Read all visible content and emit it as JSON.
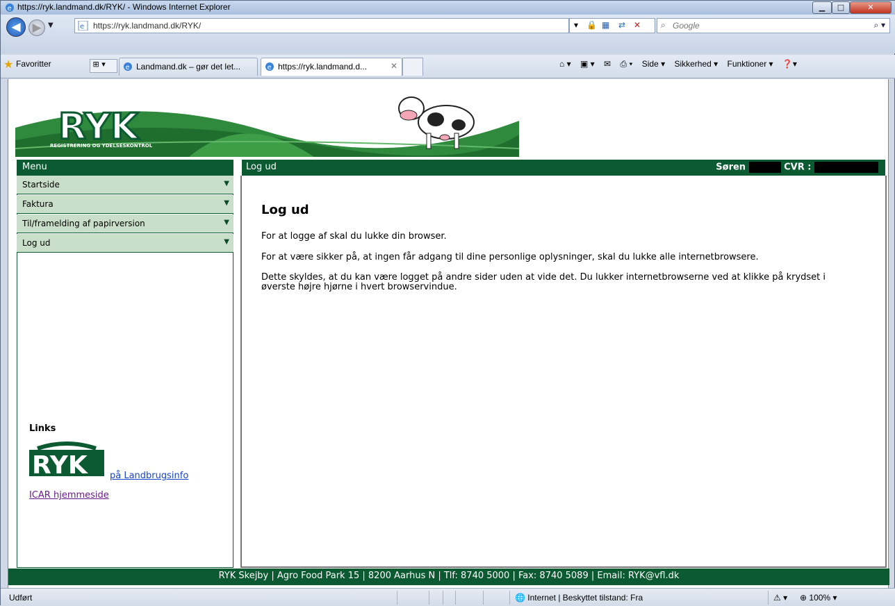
{
  "browser": {
    "title": "https://ryk.landmand.dk/RYK/ - Windows Internet Explorer",
    "address": "https://ryk.landmand.dk/RYK/",
    "search_placeholder": "Google",
    "favorites_label": "Favoritter",
    "tabs": [
      {
        "label": "Landmand.dk – gør det let..."
      },
      {
        "label": "https://ryk.landmand.d..."
      }
    ],
    "commands": [
      "Side ▾",
      "Sikkerhed ▾",
      "Funktioner ▾"
    ],
    "status_text": "Udført",
    "status_zone": "Internet | Beskyttet tilstand: Fra",
    "zoom": "100%"
  },
  "banner": {
    "logo_text": "RYK",
    "tagline": "REGISTRERING OG YDELSESKONTROL"
  },
  "sidebar": {
    "header": "Menu",
    "items": [
      {
        "label": "Startside"
      },
      {
        "label": "Faktura"
      },
      {
        "label": "Til/framelding af papirversion"
      },
      {
        "label": "Log ud"
      }
    ],
    "links_title": "Links",
    "link_landbrugsinfo": "på Landbrugsinfo",
    "link_icar": "ICAR hjemmeside"
  },
  "main": {
    "header": "Log ud",
    "user_name": "Søren",
    "cvr_label": "CVR :",
    "title": "Log ud",
    "p1": "For at logge af skal du lukke din browser.",
    "p2": "For at være sikker på, at ingen får adgang til dine personlige oplysninger, skal du lukke alle internetbrowsere.",
    "p3": "Dette skyldes, at du kan være logget på andre sider uden at vide det. Du lukker internetbrowserne ved at klikke på krydset i øverste højre hjørne i hvert browservindue."
  },
  "footer": {
    "text": "RYK Skejby | Agro Food Park 15 | 8200 Aarhus N | Tlf: 8740 5000 | Fax: 8740 5089 | Email: RYK@vfl.dk"
  }
}
